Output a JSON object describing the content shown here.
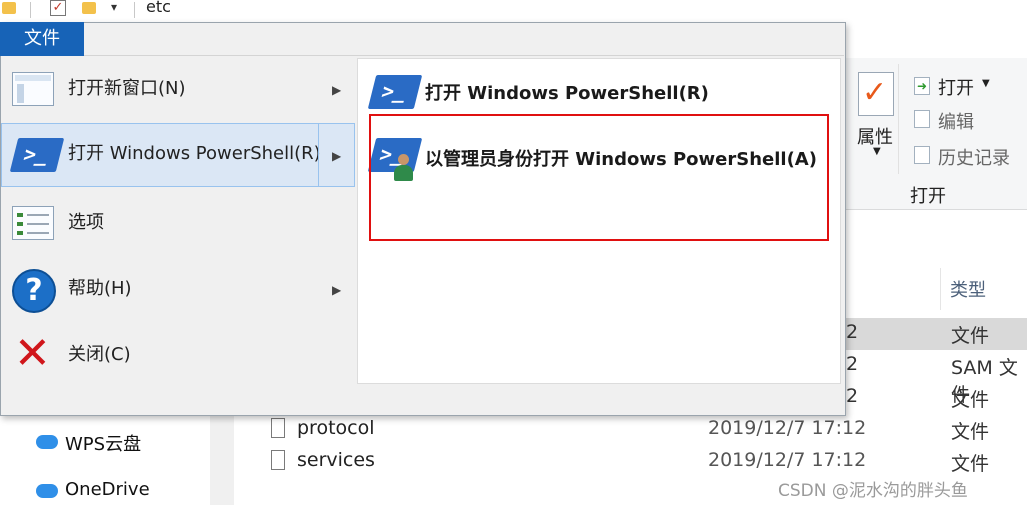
{
  "titlebar": {
    "path_text": "etc"
  },
  "file_tab": {
    "label": "文件"
  },
  "menu": {
    "items": [
      {
        "label": "打开新窗口(N)",
        "has_submenu": true
      },
      {
        "label": "打开 Windows PowerShell(R)",
        "has_submenu": true,
        "highlighted": true
      },
      {
        "label": "选项",
        "has_submenu": false
      },
      {
        "label": "帮助(H)",
        "has_submenu": true
      },
      {
        "label": "关闭(C)",
        "has_submenu": false
      }
    ],
    "submenu": [
      {
        "label": "打开 Windows PowerShell(R)"
      },
      {
        "label": "以管理员身份打开 Windows PowerShell(A)",
        "boxed": true
      }
    ]
  },
  "ribbon": {
    "properties_label": "属性",
    "open_label": "打开",
    "edit_label": "编辑",
    "history_label": "历史记录",
    "group_label": "打开"
  },
  "file_list": {
    "type_header": "类型",
    "rows_partial": [
      {
        "date_tail": "2",
        "type": "文件",
        "selected": true
      },
      {
        "date_tail": "2",
        "type": "SAM 文件"
      },
      {
        "date_tail": "2",
        "type": "文件"
      }
    ],
    "rows": [
      {
        "name": "protocol",
        "date": "2019/12/7 17:12",
        "type": "文件"
      },
      {
        "name": "services",
        "date": "2019/12/7 17:12",
        "type": "文件"
      }
    ]
  },
  "nav": {
    "items": [
      {
        "label": "WPS云盘"
      },
      {
        "label": "OneDrive"
      }
    ]
  },
  "watermark": "CSDN @泥水沟的胖头鱼",
  "colors": {
    "accent": "#1763b7",
    "highlight": "#dbe7f5",
    "red_box": "#e01010",
    "powershell": "#2a6bc5"
  }
}
